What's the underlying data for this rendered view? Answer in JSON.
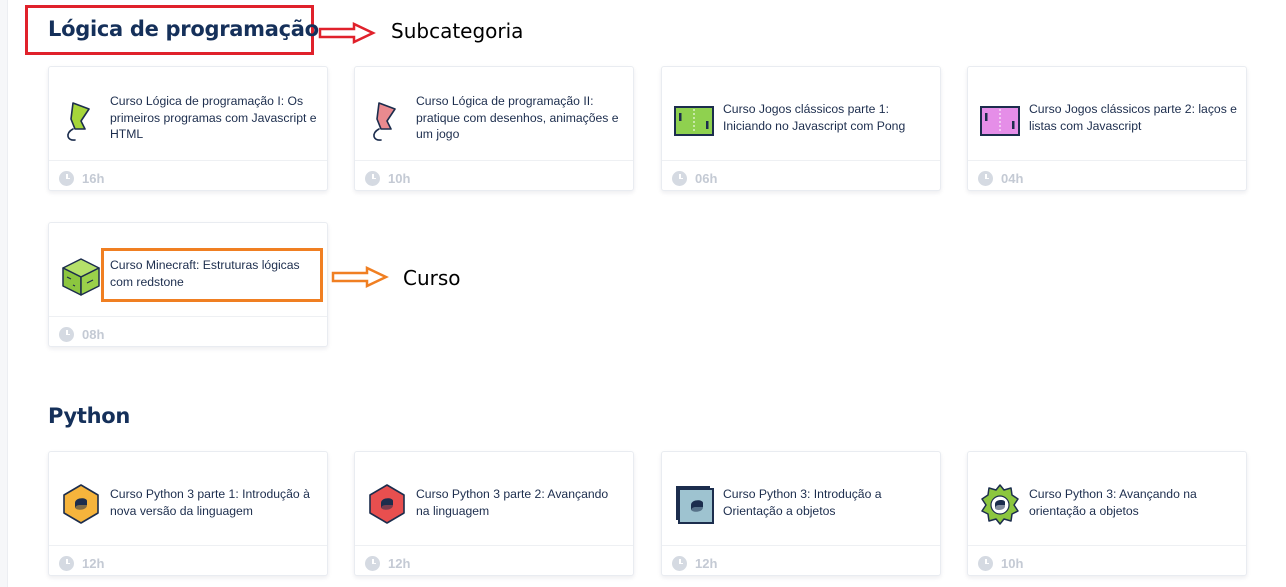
{
  "sections": [
    {
      "title": "Lógica de programação",
      "annotation": "Subcategoria",
      "courses": [
        {
          "title": "Curso Lógica de programação I: Os primeiros programas com Javascript e HTML",
          "hours": "16h",
          "icon": "snake-hook-green-icon"
        },
        {
          "title": "Curso Lógica de programação II: pratique com desenhos, animações e um jogo",
          "hours": "10h",
          "icon": "snake-hook-pink-icon"
        },
        {
          "title": "Curso Jogos clássicos parte 1: Iniciando no Javascript com Pong",
          "hours": "06h",
          "icon": "pong-green-icon"
        },
        {
          "title": "Curso Jogos clássicos parte 2: laços e listas com Javascript",
          "hours": "04h",
          "icon": "pong-pink-icon"
        },
        {
          "title": "Curso Minecraft: Estruturas lógicas com redstone",
          "hours": "08h",
          "icon": "minecraft-block-icon"
        }
      ]
    },
    {
      "title": "Python",
      "courses": [
        {
          "title": "Curso Python 3 parte 1: Introdução à nova versão da linguagem",
          "hours": "12h",
          "icon": "python-orange-hex-icon"
        },
        {
          "title": "Curso Python 3 parte 2: Avançando na linguagem",
          "hours": "12h",
          "icon": "python-red-hex-icon"
        },
        {
          "title": "Curso Python 3: Introdução a Orientação a objetos",
          "hours": "12h",
          "icon": "python-square-icon"
        },
        {
          "title": "Curso Python 3: Avançando na orientação a objetos",
          "hours": "10h",
          "icon": "python-green-gear-icon"
        }
      ]
    }
  ],
  "course_annotation": "Curso",
  "colors": {
    "highlight_red": "#e0212b",
    "highlight_orange": "#f07f22",
    "heading": "#15305a"
  }
}
